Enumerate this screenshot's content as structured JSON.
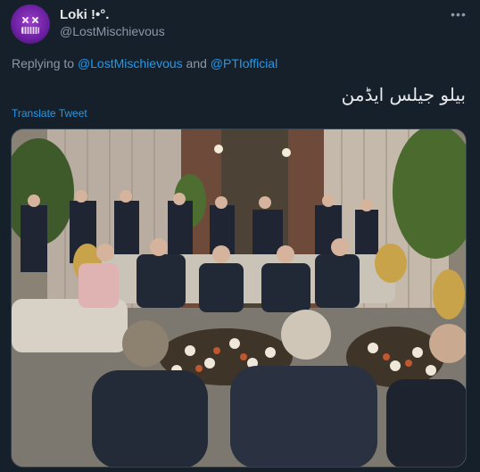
{
  "user": {
    "display_name": "Loki !•°.",
    "handle": "@LostMischievous",
    "avatar_icon": "avatar-glitch-face-icon"
  },
  "menu": {
    "more_label": "•••"
  },
  "reply": {
    "prefix": "Replying to ",
    "mention_1": "@LostMischievous",
    "connector": " and ",
    "mention_2": "@PTIofficial"
  },
  "tweet": {
    "text": "بیلو جیلس ایڈمن",
    "translate_label": "Translate Tweet"
  },
  "media": {
    "kind": "photo",
    "description_icon": "group-meeting-photo"
  },
  "colors": {
    "background": "#15202b",
    "link": "#1d9bf0",
    "secondary_text": "#8b98a5",
    "primary_text": "#e7e9ea"
  }
}
